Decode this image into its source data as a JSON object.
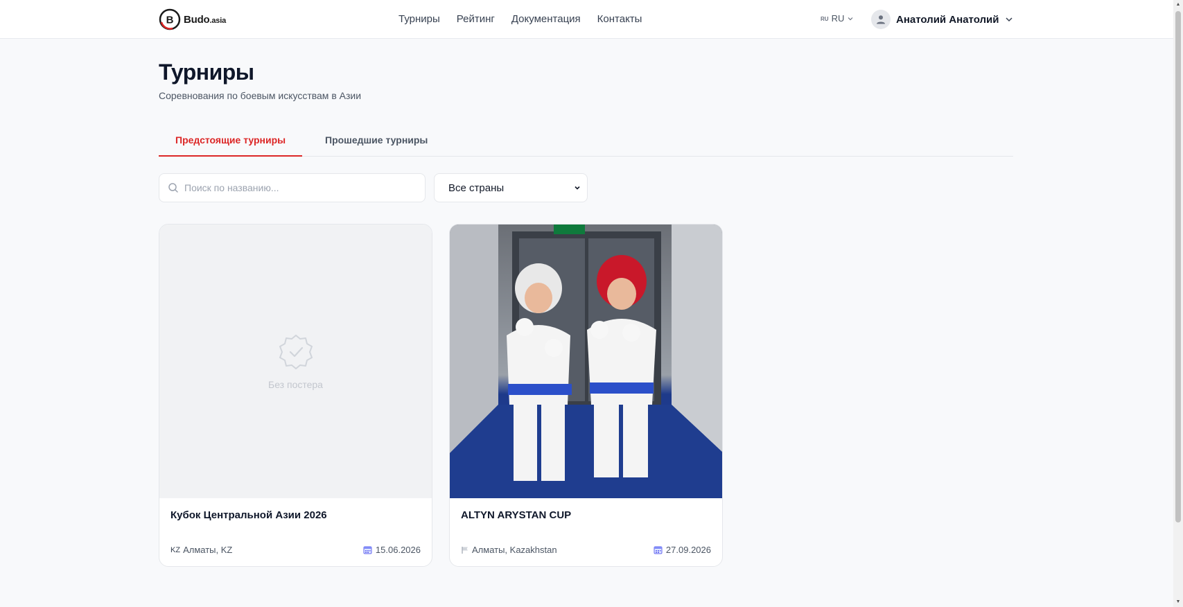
{
  "header": {
    "logo_text": "Budo",
    "logo_suffix": ".asia",
    "nav": [
      {
        "label": "Турниры"
      },
      {
        "label": "Рейтинг"
      },
      {
        "label": "Документация"
      },
      {
        "label": "Контакты"
      }
    ],
    "lang_flag": "RU",
    "lang_label": "RU",
    "user_name": "Анатолий Анатолий"
  },
  "page": {
    "title": "Турниры",
    "subtitle": "Соревнования по боевым искусствам в Азии"
  },
  "tabs": [
    {
      "label": "Предстоящие турниры",
      "active": true
    },
    {
      "label": "Прошедшие турниры",
      "active": false
    }
  ],
  "filters": {
    "search_placeholder": "Поиск по названию...",
    "country_selected": "Все страны"
  },
  "cards": [
    {
      "title": "Кубок Центральной Азии 2026",
      "no_poster_label": "Без постера",
      "country_code": "KZ",
      "location": "Алматы, KZ",
      "date": "15.06.2026"
    },
    {
      "title": "ALTYN ARYSTAN CUP",
      "location": "Алматы, Kazakhstan",
      "date": "27.09.2026"
    }
  ],
  "colors": {
    "accent": "#dc2626",
    "text": "#111827",
    "muted": "#4b5563",
    "background": "#f8f9fb"
  },
  "icons": {
    "search": "search-icon",
    "user": "user-icon",
    "calendar": "calendar-icon",
    "flag": "flag-icon",
    "verified": "verified-badge-icon"
  }
}
